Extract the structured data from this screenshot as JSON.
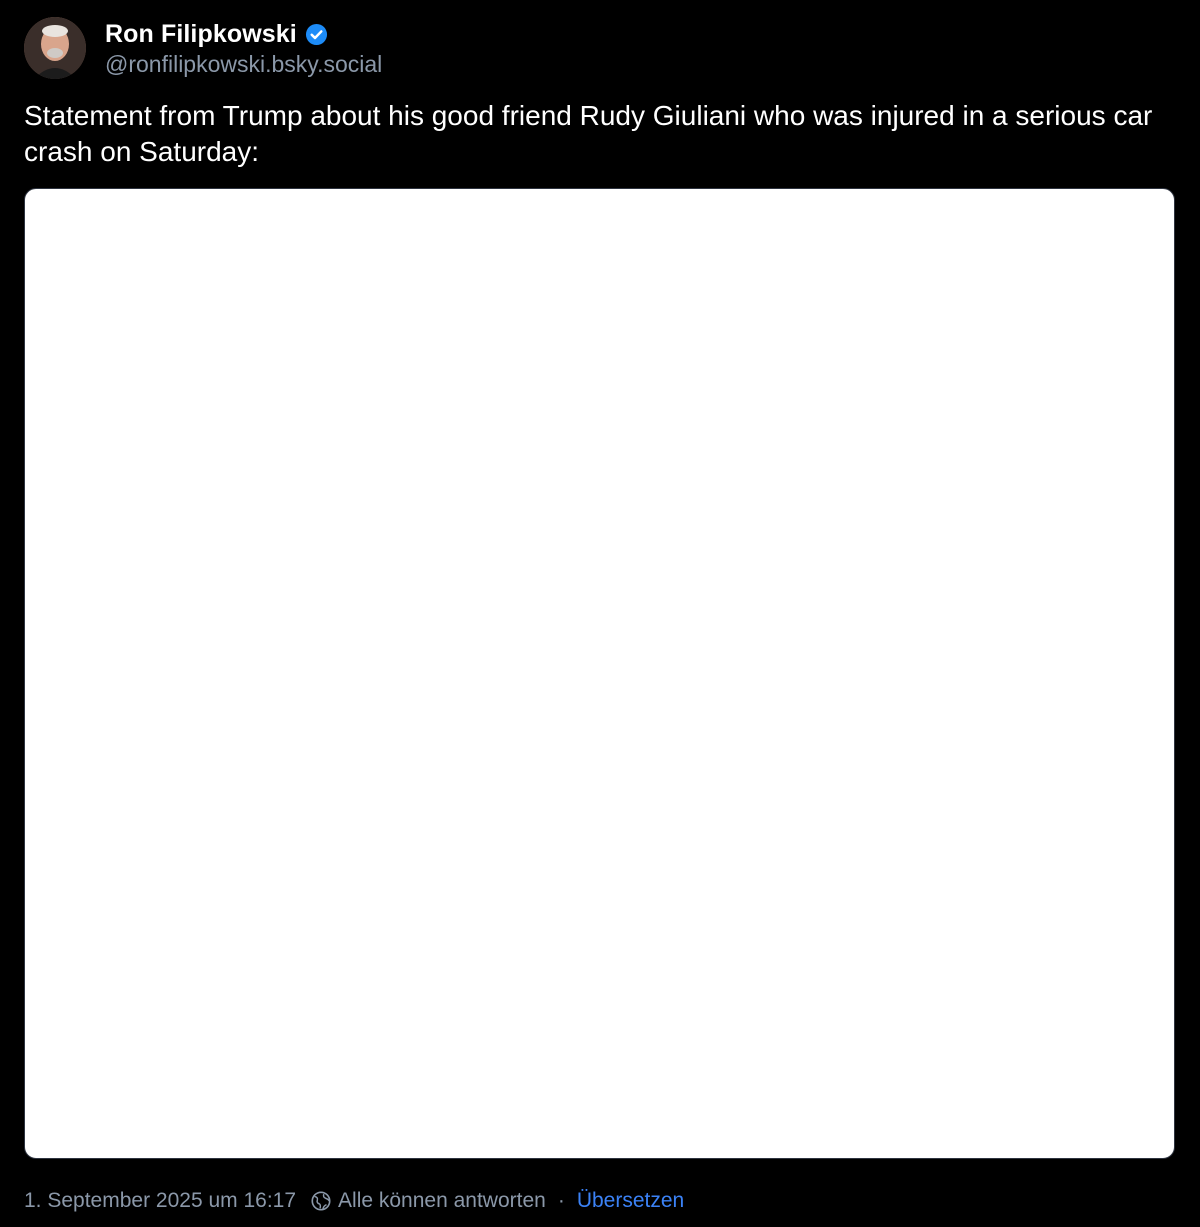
{
  "author": {
    "display_name": "Ron Filipkowski",
    "handle": "@ronfilipkowski.bsky.social",
    "verified_icon": "verified-checkmark-icon"
  },
  "post": {
    "text": "Statement from Trump about his good friend Rudy Giuliani who was injured in a serious car crash on Saturday:"
  },
  "footer": {
    "timestamp": "1. September 2025 um 16:17",
    "reply_setting_icon": "globe-icon",
    "reply_setting": "Alle können antworten",
    "separator": "·",
    "translate_label": "Übersetzen"
  },
  "colors": {
    "background": "#000000",
    "text_primary": "#ffffff",
    "text_secondary": "#8b98a9",
    "accent": "#3b82f6",
    "verified": "#1d8cf8",
    "media_background": "#ffffff"
  }
}
